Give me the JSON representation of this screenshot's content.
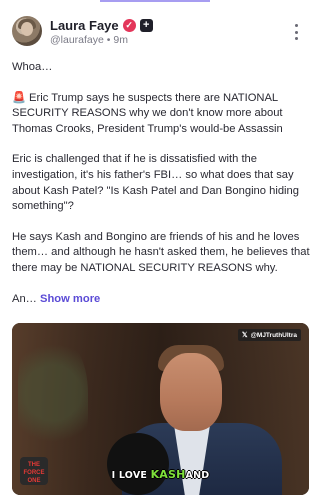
{
  "post": {
    "author": {
      "name": "Laura Faye",
      "handle": "@laurafaye",
      "time": "9m",
      "meta_separator": "•"
    },
    "body": {
      "p1": "Whoa…",
      "p2_icon": "🚨",
      "p2": "Eric Trump says he suspects there are NATIONAL SECURITY REASONS why we don't know more about Thomas Crooks, President Trump's would-be Assassin",
      "p3": "Eric is challenged that if he is dissatisfied with the investigation, it's his father's FBI… so what does that say about Kash Patel? \"Is Kash Patel and Dan Bongino hiding something\"?",
      "p4": "He says Kash and Bongino are friends of his and he loves them… and although he hasn't asked them, he believes that there may be NATIONAL SECURITY REASONS why.",
      "p5_truncated": "An…",
      "show_more": "Show more"
    },
    "media": {
      "watermark": "@MJTruthUltra",
      "caption_pre": "I LOVE",
      "caption_highlight": "KASH",
      "caption_post": "AND",
      "logo_text": "THE FORCE ONE"
    }
  },
  "colors": {
    "accent": "#5b4bd6",
    "verified_badge": "#e3365a",
    "caption_highlight": "#7ee13b"
  }
}
